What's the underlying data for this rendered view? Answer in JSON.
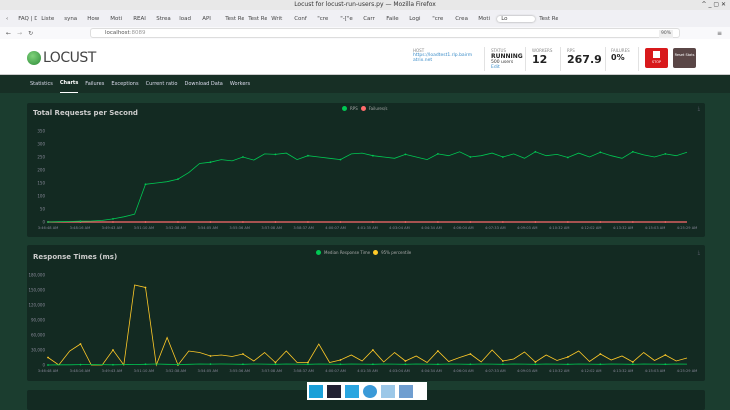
{
  "window": {
    "title": "Locust for locust-run-users.py — Mozilla Firefox",
    "controls": "^ _ ▢ ✕"
  },
  "tabs": [
    "FAQ | D",
    "Liste",
    "syna",
    "How",
    "Moti",
    "REAI",
    "Strea",
    "load",
    "API",
    "Test Re",
    "Test Re",
    "Writ",
    "Conf",
    "\"cre",
    "\"-[\"e",
    "Carr",
    "Faile",
    "Logi",
    "\"cre",
    "Crea",
    "Moti",
    "Lo",
    "Test Re"
  ],
  "active_tab": 21,
  "url": {
    "host": "localhost",
    "port": ":8089",
    "zoom": "90%"
  },
  "header": {
    "logo": "LOCUST",
    "host_label": "HOST",
    "host": "https://loadtest1.rlp.bairmatrix.net",
    "status_label": "STATUS",
    "status": "RUNNING",
    "users": "500 users",
    "edit": "Edit",
    "workers_label": "WORKERS",
    "workers": "12",
    "rps_label": "RPS",
    "rps": "267.9",
    "failures_label": "FAILURES",
    "failures": "0%",
    "stop": "STOP",
    "reset": "Reset Stats"
  },
  "nav": [
    "Statistics",
    "Charts",
    "Failures",
    "Exceptions",
    "Current ratio",
    "Download Data",
    "Workers"
  ],
  "nav_active": 1,
  "chart_data": [
    {
      "type": "line",
      "title": "Total Requests per Second",
      "ylim": [
        0,
        350
      ],
      "yticks": [
        0,
        50,
        100,
        150,
        200,
        250,
        300,
        350
      ],
      "xticks": [
        "3:46:48 AM",
        "3:48:16 AM",
        "3:49:43 AM",
        "3:51:10 AM",
        "3:52:38 AM",
        "3:54:05 AM",
        "3:55:36 AM",
        "3:57:08 AM",
        "3:58:37 AM",
        "4:00:07 AM",
        "4:01:35 AM",
        "4:03:04 AM",
        "4:04:34 AM",
        "4:06:04 AM",
        "4:07:33 AM",
        "4:09:03 AM",
        "4:10:32 AM",
        "4:12:02 AM",
        "4:13:32 AM",
        "4:15:03 AM",
        "4:25:29 AM"
      ],
      "series": [
        {
          "name": "RPS",
          "color": "#00c853",
          "values": [
            0,
            1,
            2,
            3,
            4,
            6,
            12,
            20,
            30,
            145,
            150,
            155,
            165,
            190,
            225,
            230,
            240,
            235,
            250,
            238,
            262,
            260,
            265,
            240,
            255,
            250,
            245,
            240,
            262,
            265,
            255,
            250,
            245,
            260,
            250,
            240,
            262,
            255,
            270,
            250,
            255,
            265,
            250,
            262,
            245,
            270,
            255,
            260,
            248,
            265,
            250,
            268,
            255,
            245,
            270,
            258,
            250,
            262,
            255,
            268
          ]
        },
        {
          "name": "Failures/s",
          "color": "#ff6b6b",
          "values": [
            0,
            0,
            0,
            0,
            0,
            0,
            0,
            0,
            0,
            0,
            0,
            0,
            0,
            0,
            0,
            0,
            0,
            0,
            0,
            0,
            0,
            0,
            0,
            0,
            0,
            0,
            0,
            0,
            0,
            0,
            0,
            0,
            0,
            0,
            0,
            0,
            0,
            0,
            0,
            0,
            0,
            0,
            0,
            0,
            0,
            0,
            0,
            0,
            0,
            0,
            0,
            0,
            0,
            0,
            0,
            0,
            0,
            0,
            0,
            0
          ]
        }
      ]
    },
    {
      "type": "line",
      "title": "Response Times (ms)",
      "ylim": [
        0,
        180000
      ],
      "yticks": [
        "0",
        "30,000",
        "60,000",
        "90,000",
        "120,000",
        "150,000",
        "180,000"
      ],
      "xticks": [
        "3:46:48 AM",
        "3:48:16 AM",
        "3:49:43 AM",
        "3:51:10 AM",
        "3:52:38 AM",
        "3:54:05 AM",
        "3:55:36 AM",
        "3:57:08 AM",
        "3:58:37 AM",
        "4:00:07 AM",
        "4:01:35 AM",
        "4:03:04 AM",
        "4:04:34 AM",
        "4:06:04 AM",
        "4:07:33 AM",
        "4:09:03 AM",
        "4:10:32 AM",
        "4:12:02 AM",
        "4:13:32 AM",
        "4:15:03 AM",
        "4:25:29 AM"
      ],
      "series": [
        {
          "name": "Median Response Time",
          "color": "#00c853",
          "values": [
            0,
            500,
            500,
            800,
            1000,
            800,
            500,
            800,
            1000,
            1500,
            2000,
            1500,
            1000,
            1500,
            2000,
            1800,
            2000,
            1800,
            1500,
            2000,
            1800,
            1500,
            2000,
            1800,
            1500,
            2000,
            1800,
            1500,
            2000,
            1800,
            1500,
            2000,
            1800,
            1500,
            2000,
            1800,
            1500,
            2000,
            1800,
            1500,
            2000,
            1800,
            1500,
            2000,
            1800,
            1500,
            2000,
            1800,
            1500,
            2000,
            1800,
            1500,
            2000,
            1800,
            1500,
            2000,
            1800,
            1500,
            2000,
            1800
          ]
        },
        {
          "name": "95% percentile",
          "color": "#ffca28",
          "values": [
            15000,
            0,
            28000,
            42000,
            0,
            0,
            30000,
            0,
            160000,
            155000,
            0,
            55000,
            0,
            28000,
            25000,
            18000,
            20000,
            17000,
            22000,
            8000,
            25000,
            5000,
            28000,
            5000,
            5000,
            42000,
            5000,
            10000,
            20000,
            8000,
            30000,
            6000,
            25000,
            8000,
            18000,
            5000,
            28000,
            7000,
            15000,
            22000,
            6000,
            30000,
            8000,
            12000,
            26000,
            6000,
            20000,
            9000,
            16000,
            28000,
            7000,
            22000,
            10000,
            18000,
            6000,
            25000,
            9000,
            20000,
            8000,
            14000
          ]
        }
      ]
    }
  ]
}
